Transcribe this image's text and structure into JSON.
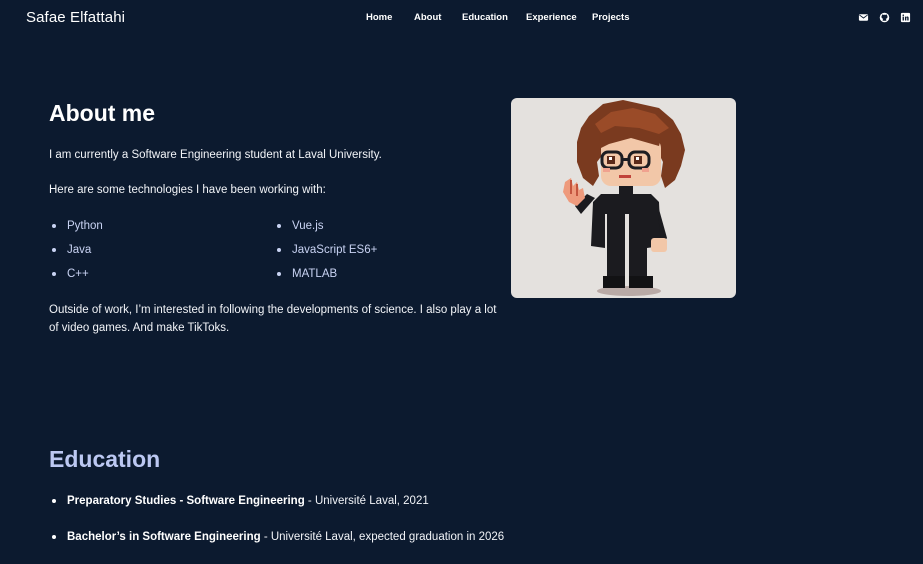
{
  "header": {
    "brand": "Safae Elfattahi",
    "nav": [
      "Home",
      "About",
      "Education",
      "Experience",
      "Projects"
    ],
    "social_icons": [
      "mail-icon",
      "github-icon",
      "linkedin-icon"
    ]
  },
  "about": {
    "title": "About me",
    "intro": "I am currently a Software Engineering student at Laval University.",
    "tech_intro": "Here are some technologies I have been working with:",
    "tech_left": [
      "Python",
      "Java",
      "C++"
    ],
    "tech_right": [
      "Vue.js",
      "JavaScript ES6+",
      "MATLAB"
    ],
    "outside": "Outside of work, I’m interested in following the developments of science. I also play a lot of video games. And make TikToks."
  },
  "education": {
    "title": "Education",
    "items": [
      {
        "bold": "Preparatory Studies - Software Engineering",
        "rest": " - Université Laval, 2021"
      },
      {
        "bold": "Bachelor’s in Software Engineering",
        "rest": " - Université Laval, expected graduation in 2026"
      }
    ]
  },
  "colors": {
    "background": "#0c1a2f",
    "accent_title": "#bcc8f2",
    "list_text": "#c9d3f3"
  }
}
